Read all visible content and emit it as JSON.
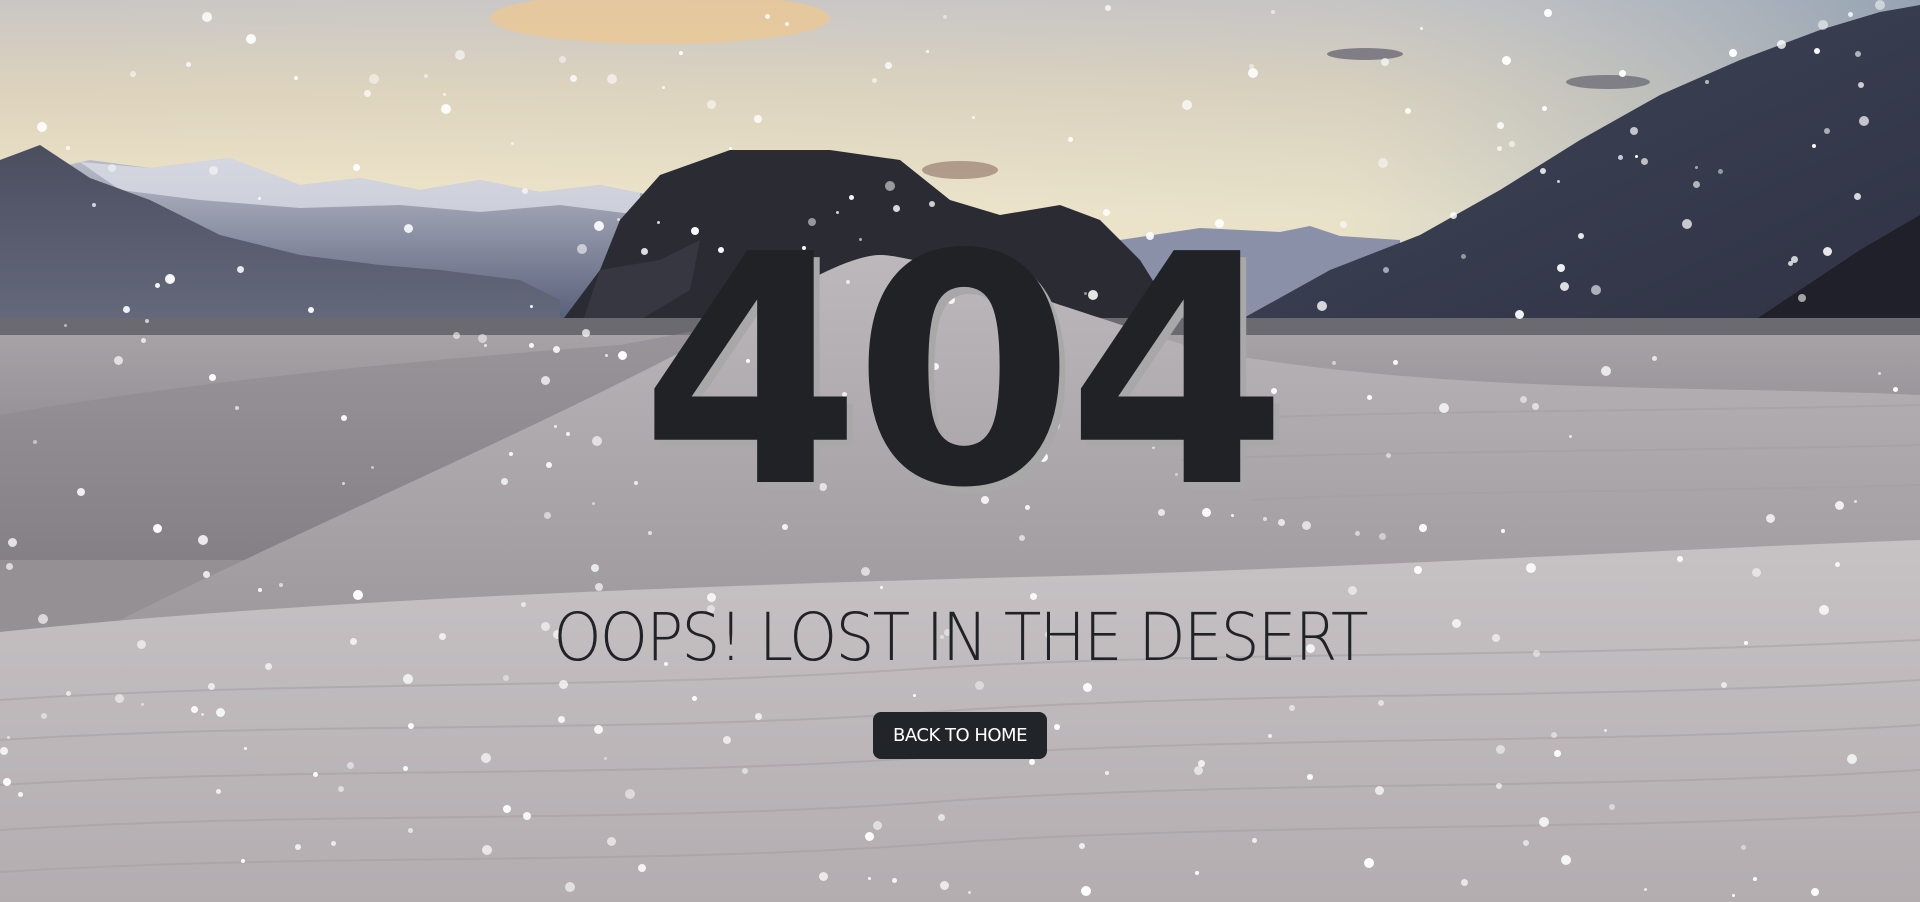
{
  "error_page": {
    "code": "404",
    "tagline": "OOPS! LOST IN THE DESERT",
    "home_button_label": "BACK TO HOME"
  },
  "background": {
    "subject": "desert dunes under mountains at dusk with falling snow"
  },
  "colors": {
    "text_dark": "#202226",
    "code_shadow": "#a9a8a8",
    "button_bg": "#212529",
    "button_text": "#ffffff",
    "snow": "#ffffff"
  }
}
